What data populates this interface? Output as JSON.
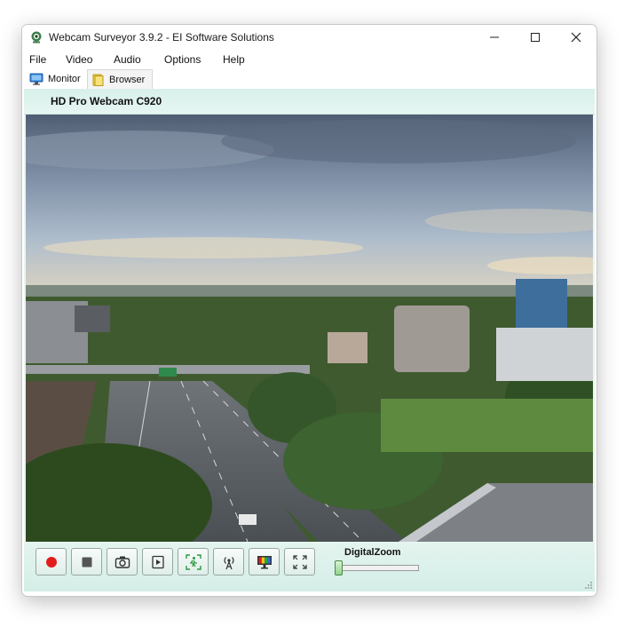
{
  "window": {
    "title": "Webcam Surveyor 3.9.2 - EI Software Solutions"
  },
  "menu": [
    "File",
    "Video",
    "Audio",
    "Options",
    "Help"
  ],
  "tabs": [
    {
      "label": "Monitor",
      "icon": "monitor-icon",
      "active": true
    },
    {
      "label": "Browser",
      "icon": "folder-icon",
      "active": false
    }
  ],
  "camera": {
    "name": "HD Pro Webcam C920"
  },
  "toolbar": {
    "buttons": [
      {
        "name": "record-button",
        "icon": "record-icon"
      },
      {
        "name": "stop-button",
        "icon": "stop-icon"
      },
      {
        "name": "snapshot-button",
        "icon": "camera-icon"
      },
      {
        "name": "play-button",
        "icon": "play-frame-icon"
      },
      {
        "name": "motion-detection-button",
        "icon": "motion-icon"
      },
      {
        "name": "broadcast-button",
        "icon": "antenna-icon"
      },
      {
        "name": "color-settings-button",
        "icon": "color-bars-icon"
      },
      {
        "name": "fullscreen-button",
        "icon": "fullscreen-icon"
      }
    ],
    "zoom_label": "DigitalZoom",
    "zoom_level": 0
  },
  "colors": {
    "record_red": "#e31b1b",
    "panel_bg": "#e9f5f1",
    "accent_green": "#8fd38a"
  }
}
